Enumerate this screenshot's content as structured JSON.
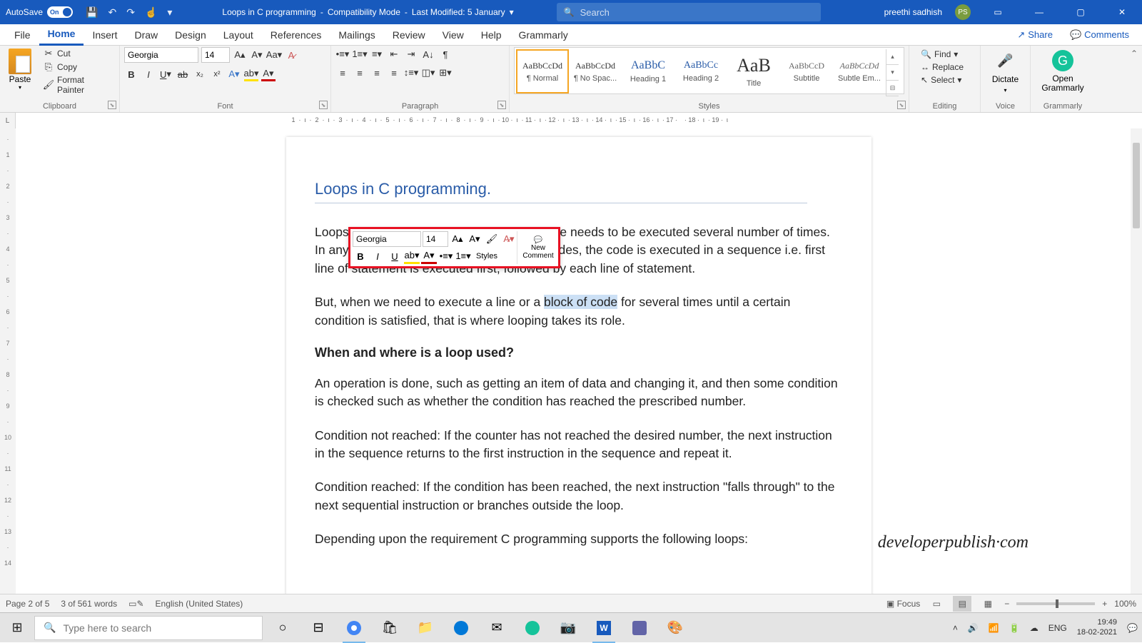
{
  "title_bar": {
    "autosave_label": "AutoSave",
    "autosave_state": "On",
    "doc_name": "Loops in C programming",
    "mode": "Compatibility Mode",
    "last_modified": "Last Modified: 5 January",
    "search_placeholder": "Search",
    "user_name": "preethi sadhish",
    "user_initials": "PS"
  },
  "tabs": {
    "items": [
      "File",
      "Home",
      "Insert",
      "Draw",
      "Design",
      "Layout",
      "References",
      "Mailings",
      "Review",
      "View",
      "Help",
      "Grammarly"
    ],
    "active": "Home",
    "share_label": "Share",
    "comments_label": "Comments"
  },
  "ribbon": {
    "clipboard": {
      "label": "Clipboard",
      "paste": "Paste",
      "cut": "Cut",
      "copy": "Copy",
      "painter": "Format Painter"
    },
    "font": {
      "label": "Font",
      "name": "Georgia",
      "size": "14"
    },
    "paragraph": {
      "label": "Paragraph"
    },
    "styles": {
      "label": "Styles",
      "items": [
        {
          "preview": "AaBbCcDd",
          "name": "¶ Normal"
        },
        {
          "preview": "AaBbCcDd",
          "name": "¶ No Spac..."
        },
        {
          "preview": "AaBbC",
          "name": "Heading 1"
        },
        {
          "preview": "AaBbCc",
          "name": "Heading 2"
        },
        {
          "preview": "AaB",
          "name": "Title"
        },
        {
          "preview": "AaBbCcD",
          "name": "Subtitle"
        },
        {
          "preview": "AaBbCcDd",
          "name": "Subtle Em..."
        }
      ]
    },
    "editing": {
      "label": "Editing",
      "find": "Find",
      "replace": "Replace",
      "select": "Select"
    },
    "voice": {
      "label": "Voice",
      "dictate": "Dictate"
    },
    "grammarly": {
      "label": "Grammarly",
      "open": "Open Grammarly"
    }
  },
  "document": {
    "heading": "Loops in C programming.",
    "p1": "Loops are used when a set or a block of code needs to be executed several number of times. In any programming language, in a set of codes, the code is executed in a sequence i.e. first line of statement is executed first, followed by each line of statement.",
    "p2_before": "But, when we need to execute a line or a ",
    "p2_selected": "block of code",
    "p2_after": " for several times until a certain condition is satisfied, that is where looping takes its role.",
    "h2": "When and where is a loop used?",
    "p3": "An operation is done, such as getting an item of data and changing it, and then some condition is checked such as whether the condition has reached the prescribed number.",
    "p4": "Condition not reached: If the counter has not reached the desired number, the next instruction in the sequence returns to the first instruction in the sequence and repeat it.",
    "p5": "Condition reached: If the condition has been reached, the next instruction \"falls through\" to the next sequential instruction or branches outside the loop.",
    "p6": "Depending upon the requirement C programming supports the following loops:",
    "watermark": "developerpublish·com"
  },
  "mini_toolbar": {
    "font": "Georgia",
    "size": "14",
    "styles": "Styles",
    "new_comment": "New Comment"
  },
  "status": {
    "page": "Page 2 of 5",
    "words": "3 of 561 words",
    "lang": "English (United States)",
    "focus": "Focus",
    "zoom": "100%"
  },
  "taskbar": {
    "search_placeholder": "Type here to search",
    "lang": "ENG",
    "time": "19:49",
    "date": "18-02-2021"
  },
  "ruler_h": "     1  ·  ι  ·  2  ·  ι  ·  3  ·  ι  ·  4  ·  ι  ·  5  ·  ι  ·  6  ·  ι  ·  7  ·  ι  ·  8  ·  ι  ·  9  ·  ι  · 10 ·  ι  · 11 ·  ι  · 12 ·  ι  · 13 ·  ι  · 14 ·  ι  · 15 ·  ι  · 16 ·  ι  · 17 ·    · 18 ·  ι  · 19 ·  ι"
}
